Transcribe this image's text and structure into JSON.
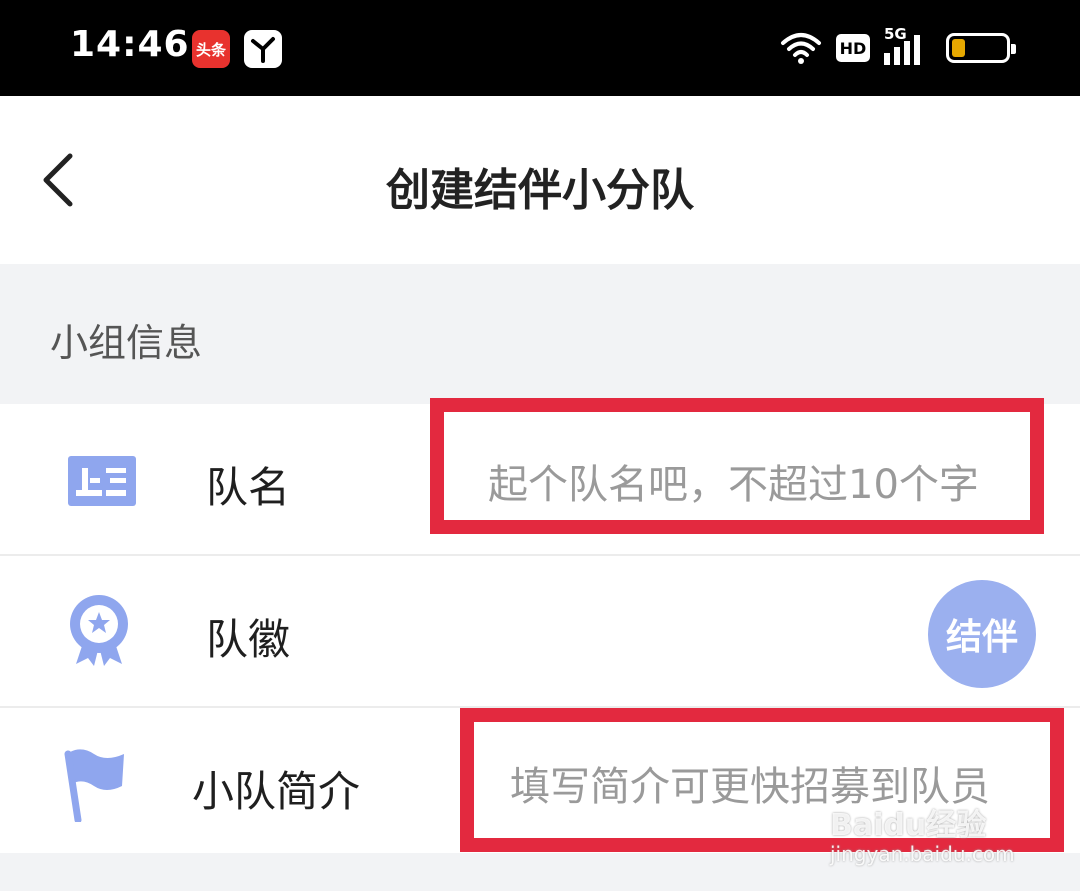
{
  "status_bar": {
    "time": "14:46",
    "app_badge": "头条",
    "network": "5G",
    "hd": "HD",
    "battery_level": 0.25,
    "battery_color": "#e6a800"
  },
  "nav": {
    "title": "创建结伴小分队",
    "back_icon": "chevron-left-icon"
  },
  "section": {
    "title": "小组信息"
  },
  "rows": [
    {
      "label": "队名",
      "icon": "id-card-icon",
      "placeholder": "起个队名吧，不超过10个字"
    },
    {
      "label": "队徽",
      "icon": "medal-icon",
      "badge_text": "结伴"
    },
    {
      "label": "小队简介",
      "icon": "flag-icon",
      "placeholder": "填写简介可更快招募到队员"
    }
  ],
  "colors": {
    "accent": "#9bb0ef",
    "highlight": "#e3293f",
    "section_bg": "#f2f3f5"
  },
  "watermark": {
    "brand": "Baidu经验",
    "url": "jingyan.baidu.com"
  }
}
